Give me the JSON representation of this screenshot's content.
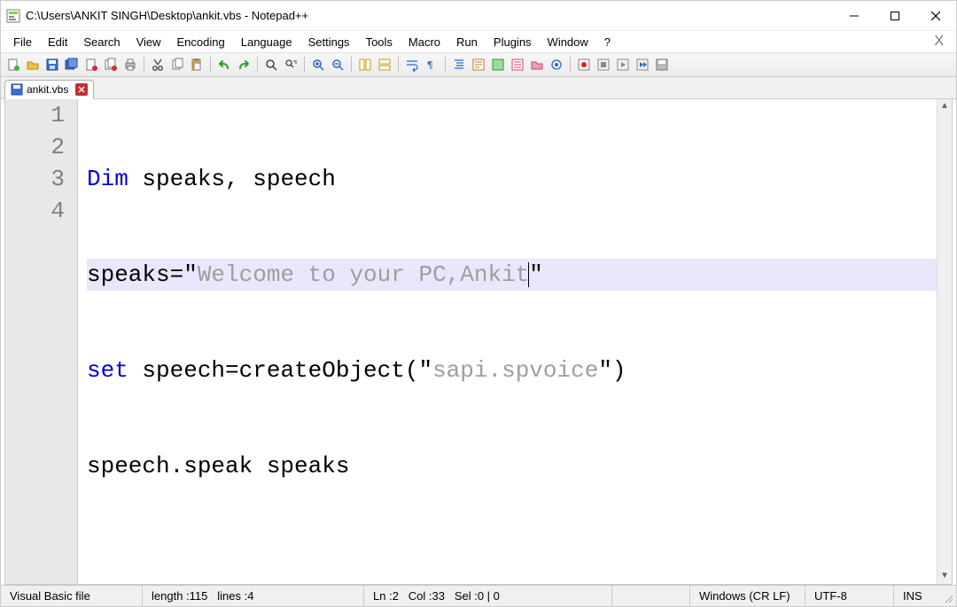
{
  "window": {
    "title": "C:\\Users\\ANKIT SINGH\\Desktop\\ankit.vbs - Notepad++"
  },
  "menus": {
    "file": "File",
    "edit": "Edit",
    "search": "Search",
    "view": "View",
    "encoding": "Encoding",
    "language": "Language",
    "settings": "Settings",
    "tools": "Tools",
    "macro": "Macro",
    "run": "Run",
    "plugins": "Plugins",
    "window": "Window",
    "help": "?"
  },
  "tab": {
    "filename": "ankit.vbs"
  },
  "gutter": {
    "l1": "1",
    "l2": "2",
    "l3": "3",
    "l4": "4"
  },
  "code": {
    "l1_kw": "Dim",
    "l1_rest": " speaks, speech",
    "l2_a": "speaks=",
    "l2_q1": "\"",
    "l2_str": "Welcome to your PC,Ankit",
    "l2_q2": "\"",
    "l3_kw": "set",
    "l3_b": " speech=createObject(",
    "l3_q1": "\"",
    "l3_str": "sapi.spvoice",
    "l3_q2": "\"",
    "l3_c": ")",
    "l4": "speech.speak speaks"
  },
  "status": {
    "lang": "Visual Basic file",
    "length_label": "length : ",
    "length_val": "115",
    "lines_label": "lines : ",
    "lines_val": "4",
    "ln_label": "Ln : ",
    "ln_val": "2",
    "col_label": "Col : ",
    "col_val": "33",
    "sel_label": "Sel : ",
    "sel_val": "0 | 0",
    "eol": "Windows (CR LF)",
    "enc": "UTF-8",
    "ins": "INS"
  }
}
